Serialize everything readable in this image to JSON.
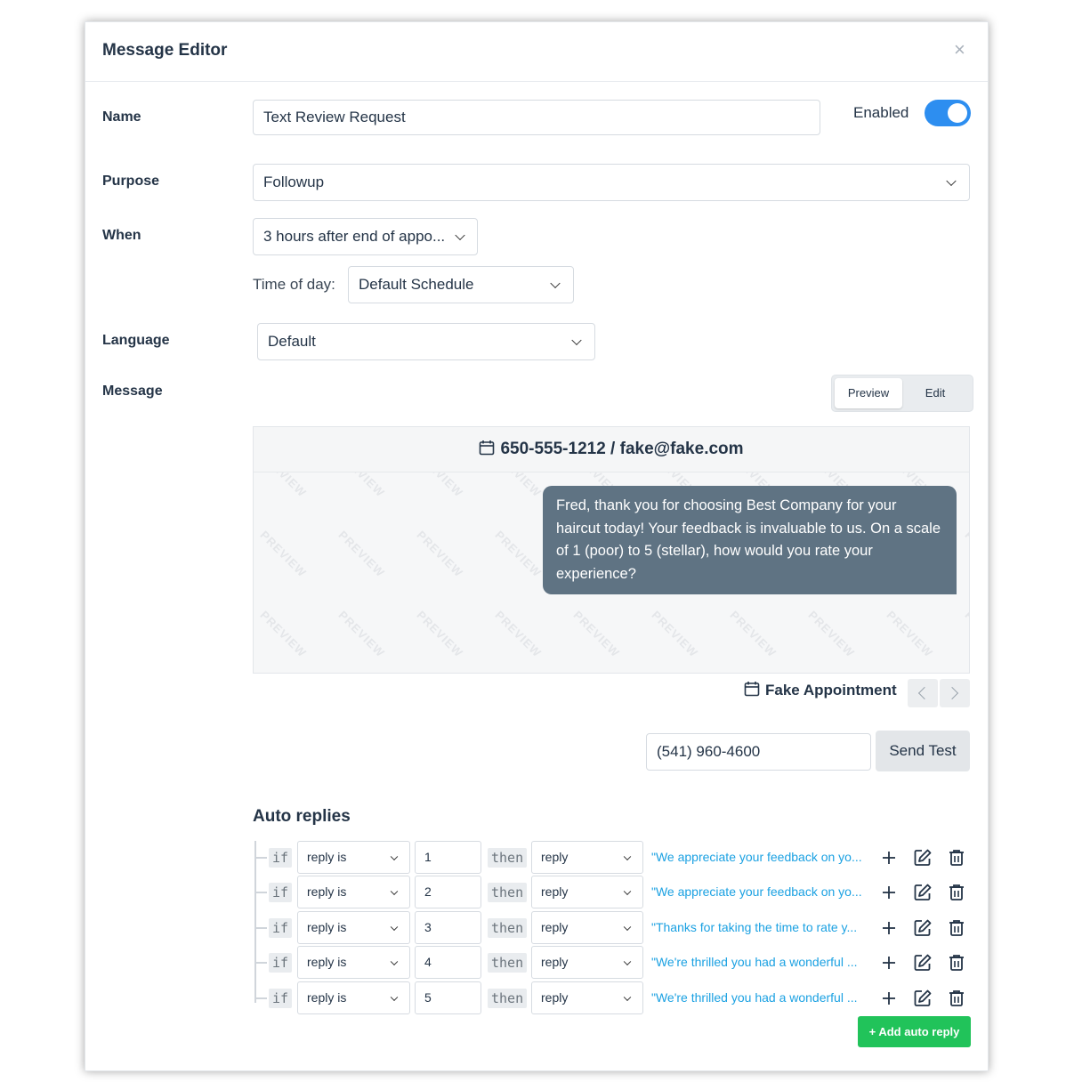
{
  "modal": {
    "title": "Message Editor",
    "close": "×"
  },
  "form": {
    "name_label": "Name",
    "name_value": "Text Review Request",
    "enabled_label": "Enabled",
    "enabled": true,
    "purpose_label": "Purpose",
    "purpose_value": "Followup",
    "when_label": "When",
    "when_value": "3 hours after end of appo...",
    "time_of_day_label": "Time of day:",
    "time_of_day_value": "Default Schedule",
    "language_label": "Language",
    "language_value": "Default",
    "message_label": "Message"
  },
  "view_toggle": {
    "preview": "Preview",
    "edit": "Edit",
    "active": "Preview"
  },
  "preview": {
    "contact": "650-555-1212 / fake@fake.com",
    "watermark": "PREVIEW",
    "message": "Fred, thank you for choosing Best Company for your haircut today! Your feedback is invaluable to us. On a scale of 1 (poor) to 5 (stellar), how would you rate your experience?",
    "appointment": "Fake Appointment"
  },
  "test": {
    "phone_value": "(541) 960-4600",
    "send_label": "Send Test"
  },
  "auto_replies": {
    "title": "Auto replies",
    "if_kw": "if",
    "then_kw": "then",
    "rules": [
      {
        "condition": "reply is",
        "value": "1",
        "action": "reply",
        "text": "\"We appreciate your feedback on yo..."
      },
      {
        "condition": "reply is",
        "value": "2",
        "action": "reply",
        "text": "\"We appreciate your feedback on yo..."
      },
      {
        "condition": "reply is",
        "value": "3",
        "action": "reply",
        "text": "\"Thanks for taking the time to rate y..."
      },
      {
        "condition": "reply is",
        "value": "4",
        "action": "reply",
        "text": "\"We're thrilled you had a wonderful ..."
      },
      {
        "condition": "reply is",
        "value": "5",
        "action": "reply",
        "text": "\"We're thrilled you had a wonderful ..."
      }
    ],
    "add_label": "+ Add auto reply"
  },
  "colors": {
    "accent": "#2d8ef0",
    "bubble": "#5f7383",
    "link": "#1ba1e2",
    "add_button": "#21c35a"
  },
  "icons": {
    "calendar": "calendar-icon",
    "plus": "plus-icon",
    "edit": "edit-icon",
    "trash": "trash-icon",
    "close": "close-icon"
  }
}
